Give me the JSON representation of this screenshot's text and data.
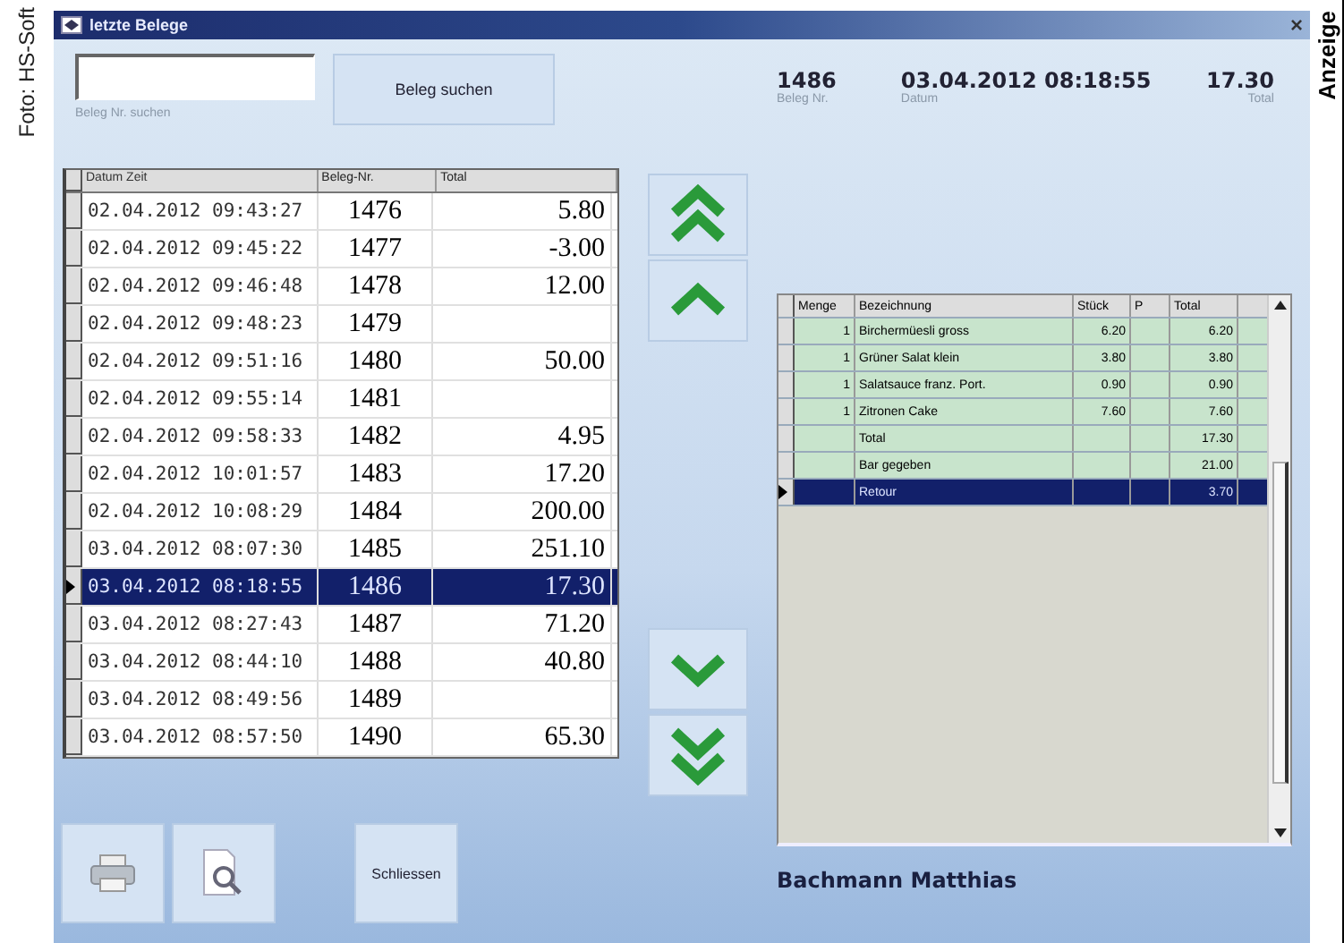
{
  "side_credit": "Foto: HS-Soft",
  "side_label": "Anzeige",
  "window": {
    "title": "letzte Belege",
    "close": "×"
  },
  "search": {
    "caption": "Beleg Nr. suchen",
    "button": "Beleg suchen"
  },
  "summary": [
    {
      "value": "1486",
      "caption": "Beleg Nr."
    },
    {
      "value": "03.04.2012 08:18:55",
      "caption": "Datum"
    },
    {
      "value": "17.30",
      "caption": "Total"
    }
  ],
  "receipts": {
    "columns": [
      "Datum Zeit",
      "Beleg-Nr.",
      "Total"
    ],
    "rows": [
      {
        "datetime": "02.04.2012 09:43:27",
        "number": "1476",
        "total": "5.80",
        "selected": false
      },
      {
        "datetime": "02.04.2012 09:45:22",
        "number": "1477",
        "total": "-3.00",
        "selected": false
      },
      {
        "datetime": "02.04.2012 09:46:48",
        "number": "1478",
        "total": "12.00",
        "selected": false
      },
      {
        "datetime": "02.04.2012 09:48:23",
        "number": "1479",
        "selected": false
      },
      {
        "datetime": "02.04.2012 09:51:16",
        "number": "1480",
        "total": "50.00",
        "selected": false
      },
      {
        "datetime": "02.04.2012 09:55:14",
        "number": "1481",
        "selected": false
      },
      {
        "datetime": "02.04.2012 09:58:33",
        "number": "1482",
        "total": "4.95",
        "selected": false
      },
      {
        "datetime": "02.04.2012 10:01:57",
        "number": "1483",
        "total": "17.20",
        "selected": false
      },
      {
        "datetime": "02.04.2012 10:08:29",
        "number": "1484",
        "total": "200.00",
        "selected": false
      },
      {
        "datetime": "03.04.2012 08:07:30",
        "number": "1485",
        "total": "251.10",
        "selected": false
      },
      {
        "datetime": "03.04.2012 08:18:55",
        "number": "1486",
        "total": "17.30",
        "selected": true
      },
      {
        "datetime": "03.04.2012 08:27:43",
        "number": "1487",
        "total": "71.20",
        "selected": false
      },
      {
        "datetime": "03.04.2012 08:44:10",
        "number": "1488",
        "total": "40.80",
        "selected": false
      },
      {
        "datetime": "03.04.2012 08:49:56",
        "number": "1489",
        "selected": false
      },
      {
        "datetime": "03.04.2012 08:57:50",
        "number": "1490",
        "total": "65.30",
        "selected": false
      }
    ]
  },
  "nav_top": [
    {
      "kind": "double_up"
    },
    {
      "kind": "up"
    }
  ],
  "nav_bottom": [
    {
      "kind": "down"
    },
    {
      "kind": "double_down"
    }
  ],
  "tools": [
    {
      "kind": "print"
    },
    {
      "kind": "preview"
    },
    {
      "kind": "text",
      "label": "Schliessen"
    }
  ],
  "items": {
    "columns": [
      "Menge",
      "Bezeichnung",
      "Stück",
      "P",
      "Total"
    ],
    "rows": [
      {
        "qty": "1",
        "name": "Birchermüesli gross",
        "price": "6.20",
        "total": "6.20",
        "selected": false
      },
      {
        "qty": "1",
        "name": "Grüner Salat klein",
        "price": "3.80",
        "total": "3.80",
        "selected": false
      },
      {
        "qty": "1",
        "name": "Salatsauce franz. Port.",
        "price": "0.90",
        "total": "0.90",
        "selected": false
      },
      {
        "qty": "1",
        "name": "Zitronen Cake",
        "price": "7.60",
        "total": "7.60",
        "selected": false
      },
      {
        "name": "Total",
        "total": "17.30",
        "selected": false
      },
      {
        "name": "Bar gegeben",
        "total": "21.00",
        "selected": false
      },
      {
        "name": "Retour",
        "total": "3.70",
        "selected": true
      }
    ]
  },
  "cashier": "Bachmann Matthias"
}
